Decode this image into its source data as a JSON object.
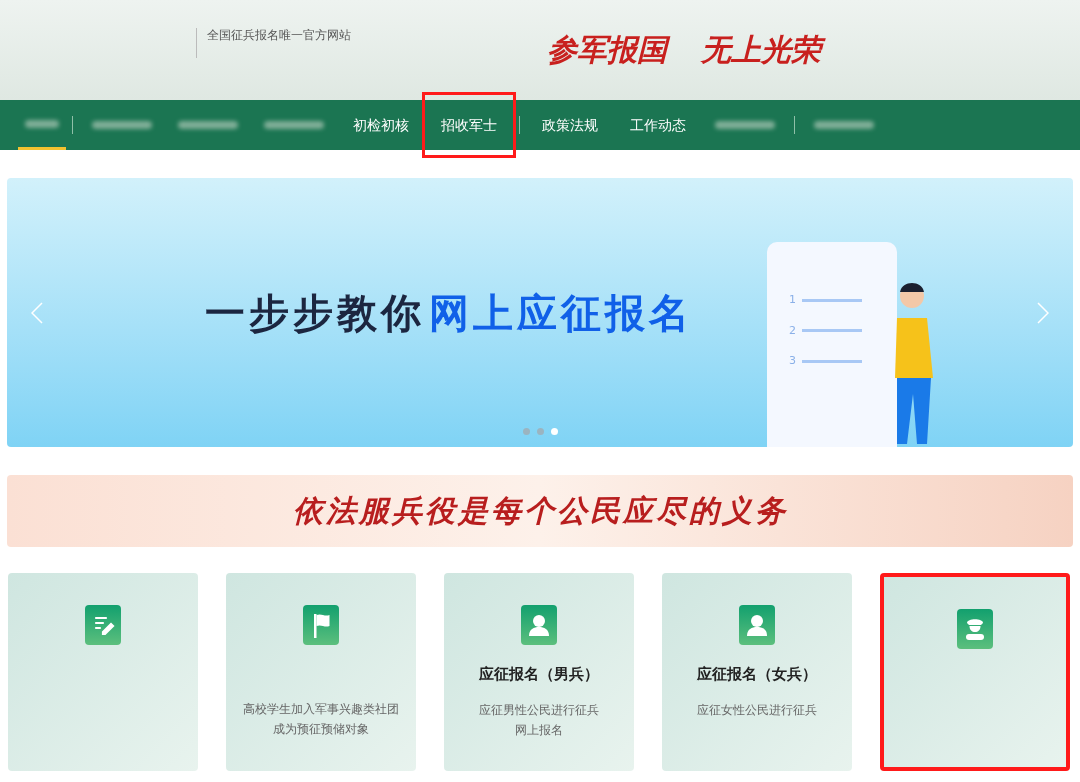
{
  "header": {
    "tagline": "全国征兵报名唯一官方网站",
    "slogan": [
      "参军报国",
      "无上光荣"
    ]
  },
  "nav": [
    {
      "kind": "blurred",
      "selected": true,
      "highlighted": false
    },
    {
      "kind": "blurred",
      "selected": false,
      "highlighted": false
    },
    {
      "kind": "blurred",
      "selected": false,
      "highlighted": false
    },
    {
      "kind": "blurred",
      "selected": false,
      "highlighted": false
    },
    {
      "kind": "text",
      "label": "初检初核",
      "selected": false,
      "highlighted": false
    },
    {
      "kind": "text",
      "label": "招收军士",
      "selected": false,
      "highlighted": true
    },
    {
      "kind": "text",
      "label": "政策法规",
      "selected": false,
      "highlighted": false
    },
    {
      "kind": "text",
      "label": "工作动态",
      "selected": false,
      "highlighted": false
    },
    {
      "kind": "blurred",
      "selected": false,
      "highlighted": false
    },
    {
      "kind": "blurred",
      "selected": false,
      "highlighted": false
    }
  ],
  "banner": {
    "title": "一步步教你",
    "title_highlight": "网上应征报名",
    "list_numbers": [
      "1",
      "2",
      "3"
    ],
    "dots": [
      {
        "selected": false
      },
      {
        "selected": false
      },
      {
        "selected": true
      }
    ]
  },
  "motto": "依法服兵役是每个公民应尽的义务",
  "cards": [
    {
      "kind": "form",
      "highlighted": false
    },
    {
      "kind": "flag",
      "description": [
        "高校学生加入军事兴趣类社团",
        "成为预征预储对象"
      ],
      "highlighted": false
    },
    {
      "kind": "person",
      "title": "应征报名（男兵）",
      "description": [
        "应征男性公民进行征兵",
        "网上报名"
      ],
      "highlighted": false
    },
    {
      "kind": "person",
      "title": "应征报名（女兵）",
      "description": [
        "应征女性公民进行征兵"
      ],
      "highlighted": false
    },
    {
      "kind": "soldier",
      "highlighted": true
    }
  ]
}
